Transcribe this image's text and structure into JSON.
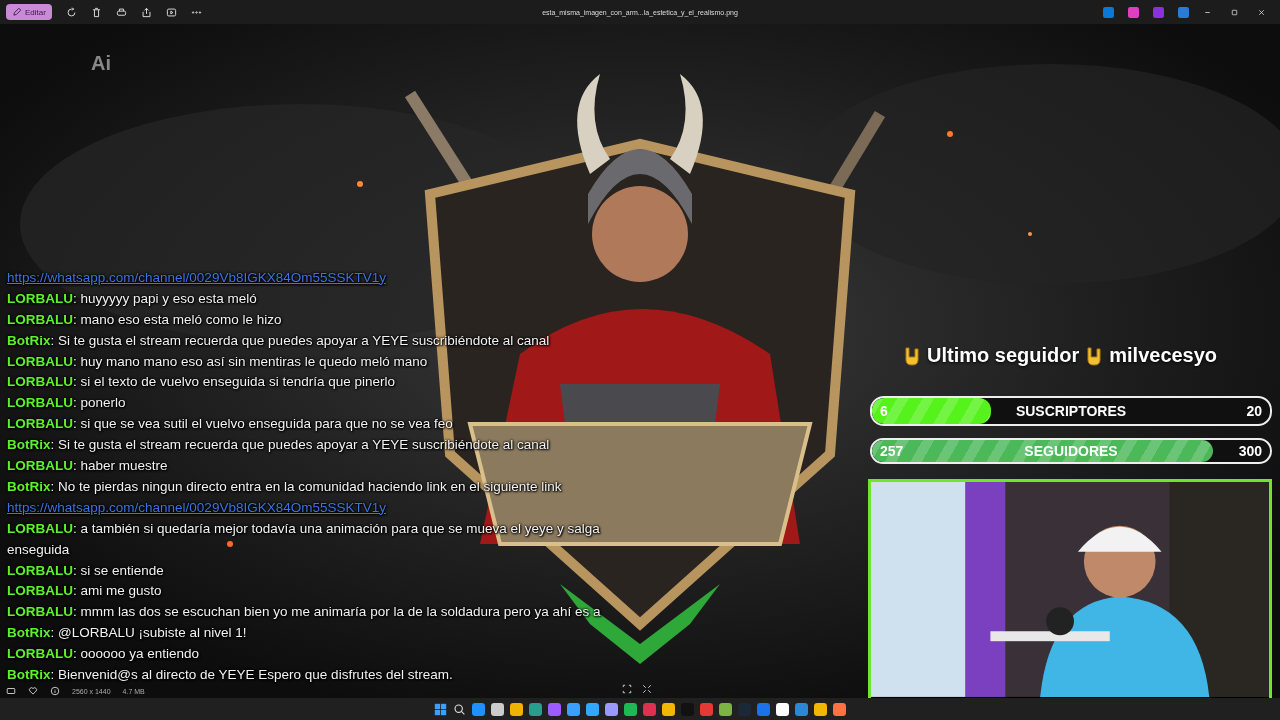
{
  "toolbar": {
    "edit_button": "Editar",
    "file_name": "esta_misma_imagen_con_arm...la_estetica_y_el_realismo.png"
  },
  "viewer": {
    "ai_badge": "Ai",
    "chat": [
      {
        "kind": "link",
        "text": "https://whatsapp.com/channel/0029Vb8IGKX84Om55SSKTV1y"
      },
      {
        "kind": "message",
        "user": "LORBALU",
        "text": ": huyyyyy papi y eso esta meló"
      },
      {
        "kind": "message",
        "user": "LORBALU",
        "text": ": mano eso esta meló como le hizo"
      },
      {
        "kind": "message",
        "user": "BotRix",
        "text": ": Si te gusta el stream recuerda que puedes apoyar a YEYE suscribiéndote al canal"
      },
      {
        "kind": "message",
        "user": "LORBALU",
        "text": ": huy mano mano eso así sin mentiras le quedo meló mano"
      },
      {
        "kind": "message",
        "user": "LORBALU",
        "text": ": si el texto de vuelvo enseguida si tendría que pinerlo"
      },
      {
        "kind": "message",
        "user": "LORBALU",
        "text": ": ponerlo"
      },
      {
        "kind": "message",
        "user": "LORBALU",
        "text": ": si que se vea sutil el vuelvo enseguida para que no se vea feo"
      },
      {
        "kind": "message",
        "user": "BotRix",
        "text": ": Si te gusta el stream recuerda que puedes apoyar a YEYE suscribiéndote al canal"
      },
      {
        "kind": "message",
        "user": "LORBALU",
        "text": ": haber muestre"
      },
      {
        "kind": "message",
        "user": "BotRix",
        "text": ": No te pierdas ningun directo entra en la comunidad haciendo link en el siguiente link"
      },
      {
        "kind": "link",
        "text": "https://whatsapp.com/channel/0029Vb8IGKX84Om55SSKTV1y"
      },
      {
        "kind": "message",
        "user": "LORBALU",
        "text": ": a también si quedaría mejor todavía una animación para que se mueva el yeye y salga enseguida"
      },
      {
        "kind": "message",
        "user": "LORBALU",
        "text": ": si se entiende"
      },
      {
        "kind": "message",
        "user": "LORBALU",
        "text": ": ami me gusto"
      },
      {
        "kind": "message",
        "user": "LORBALU",
        "text": ": mmm las dos se escuchan bien yo me animaría por la de la soldadura pero ya ahí es a"
      },
      {
        "kind": "message",
        "user": "BotRix",
        "text": ": @LORBALU ¡subiste al nivel 1!"
      },
      {
        "kind": "message",
        "user": "LORBALU",
        "text": ": oooooo ya entiendo"
      },
      {
        "kind": "message",
        "user": "BotRix",
        "text": ": Bienvenid@s al directo de YEYE Espero que disfrutes del stream."
      }
    ],
    "follower": {
      "label": "Ultimo seguidor",
      "name": "milvecesyo"
    },
    "goals": [
      {
        "current": "6",
        "label": "SUSCRIPTORES",
        "target": "20",
        "level": 0.3,
        "color": "#55f21c"
      },
      {
        "current": "257",
        "label": "SEGUIDORES",
        "target": "300",
        "level": 0.857,
        "color": "#4bb85a"
      }
    ]
  },
  "info_bar": {
    "dimensions": "2560 x 1440",
    "file_size": "4.7 MB"
  }
}
